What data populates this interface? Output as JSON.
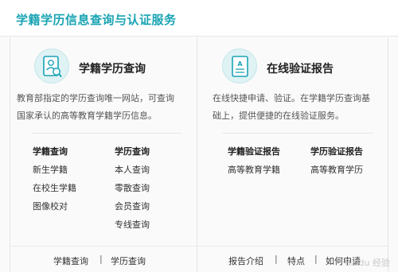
{
  "header": {
    "title": "学籍学历信息查询与认证服务"
  },
  "left": {
    "icon": "student-id-search-icon",
    "title": "学籍学历查询",
    "desc_line1": "教育部指定的学历查询唯一网站，可查询",
    "desc_line2": "国家承认的高等教育学籍学历信息。",
    "col1": {
      "head": "学籍查询",
      "items": [
        "新生学籍",
        "在校生学籍",
        "图像校对"
      ]
    },
    "col2": {
      "head": "学历查询",
      "items": [
        "本人查询",
        "零散查询",
        "会员查询",
        "专线查询"
      ]
    },
    "footer": [
      "学籍查询",
      "学历查询"
    ]
  },
  "right": {
    "icon": "certificate-icon",
    "title": "在线验证报告",
    "desc_line1": "在线快捷申请、验证。在学籍学历查询基",
    "desc_line2": "础上，提供便捷的在线验证服务。",
    "col1": {
      "head": "学籍验证报告",
      "items": [
        "高等教育学籍"
      ]
    },
    "col2": {
      "head": "学历验证报告",
      "items": [
        "高等教育学历"
      ]
    },
    "footer": [
      "报告介绍",
      "特点",
      "如何申请"
    ]
  },
  "separator": "|",
  "watermark": "Baidu 经验",
  "colors": {
    "accent": "#1aa4b4",
    "icon_bg": "#dff2f4"
  }
}
